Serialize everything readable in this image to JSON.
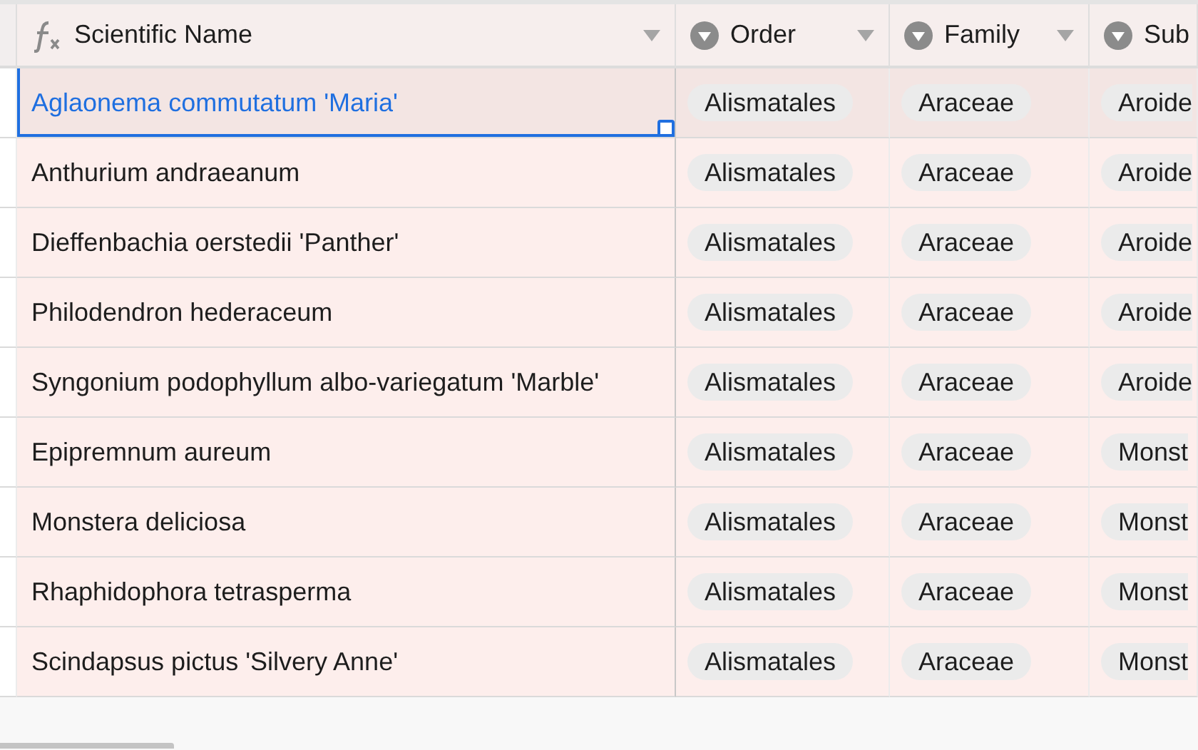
{
  "columns": [
    {
      "label": "Scientific Name",
      "kind": "formula",
      "menu": true
    },
    {
      "label": "Order",
      "kind": "select",
      "menu": true
    },
    {
      "label": "Family",
      "kind": "select",
      "menu": true
    },
    {
      "label": "Sub",
      "kind": "select",
      "menu": false
    }
  ],
  "rows": [
    {
      "selected": true,
      "cells": [
        "Aglaonema commutatum 'Maria'",
        "Alismatales",
        "Araceae",
        "Aroide"
      ]
    },
    {
      "selected": false,
      "cells": [
        "Anthurium andraeanum",
        "Alismatales",
        "Araceae",
        "Aroide"
      ]
    },
    {
      "selected": false,
      "cells": [
        "Dieffenbachia oerstedii 'Panther'",
        "Alismatales",
        "Araceae",
        "Aroide"
      ]
    },
    {
      "selected": false,
      "cells": [
        "Philodendron hederaceum",
        "Alismatales",
        "Araceae",
        "Aroide"
      ]
    },
    {
      "selected": false,
      "cells": [
        "Syngonium podophyllum albo-variegatum 'Marble'",
        "Alismatales",
        "Araceae",
        "Aroide"
      ]
    },
    {
      "selected": false,
      "cells": [
        "Epipremnum aureum",
        "Alismatales",
        "Araceae",
        "Monst"
      ]
    },
    {
      "selected": false,
      "cells": [
        "Monstera deliciosa",
        "Alismatales",
        "Araceae",
        "Monst"
      ]
    },
    {
      "selected": false,
      "cells": [
        "Rhaphidophora tetrasperma",
        "Alismatales",
        "Araceae",
        "Monst"
      ]
    },
    {
      "selected": false,
      "cells": [
        "Scindapsus pictus 'Silvery Anne'",
        "Alismatales",
        "Araceae",
        "Monst"
      ]
    }
  ]
}
